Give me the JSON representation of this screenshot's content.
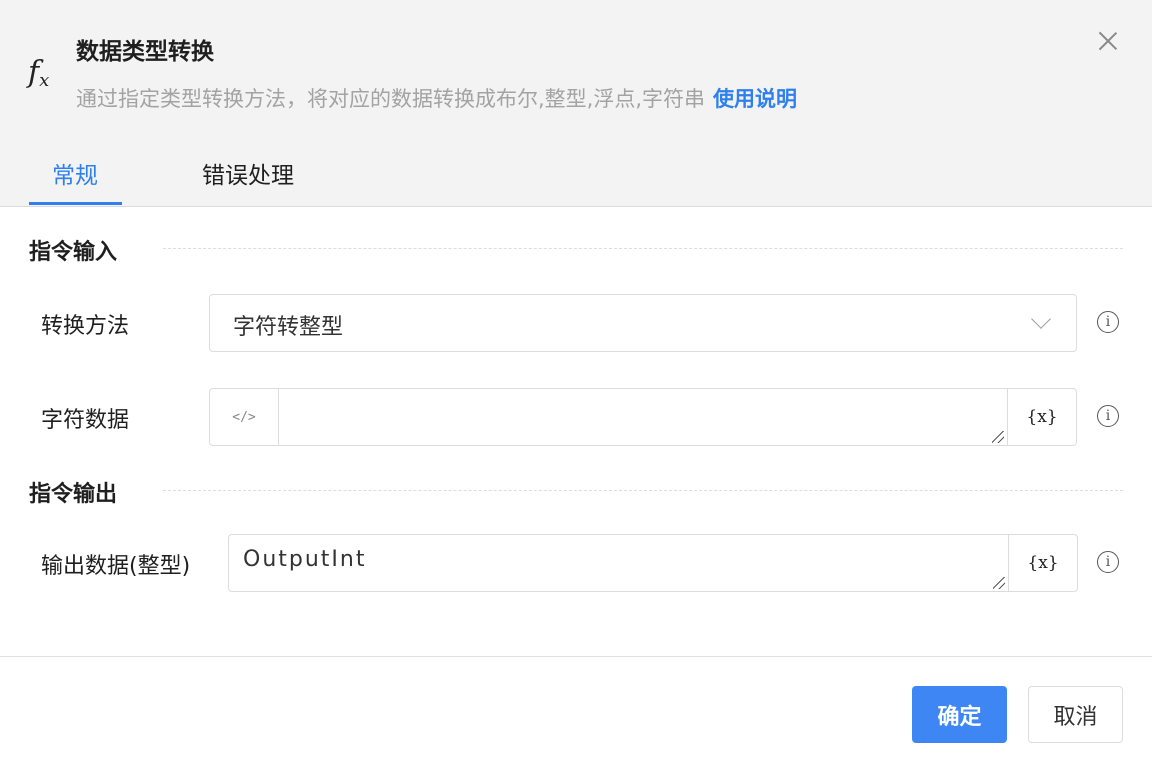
{
  "header": {
    "icon": "function-fx-icon",
    "title": "数据类型转换",
    "subtitle": "通过指定类型转换方法，将对应的数据转换成布尔,整型,浮点,字符串",
    "help_link": "使用说明"
  },
  "tabs": [
    {
      "label": "常规",
      "active": true
    },
    {
      "label": "错误处理",
      "active": false
    }
  ],
  "input_section": {
    "title": "指令输入",
    "convert_method": {
      "label": "转换方法",
      "selected": "字符转整型"
    },
    "char_data": {
      "label": "字符数据",
      "prefix": "</>",
      "value": "",
      "var_button": "{x}"
    }
  },
  "output_section": {
    "title": "指令输出",
    "output_data": {
      "label": "输出数据(整型)",
      "value": "OutputInt",
      "var_button": "{x}"
    }
  },
  "footer": {
    "ok_label": "确定",
    "cancel_label": "取消"
  },
  "colors": {
    "accent": "#2f80ed",
    "primary_button": "#3d86f4",
    "header_bg": "#f3f3f3"
  }
}
